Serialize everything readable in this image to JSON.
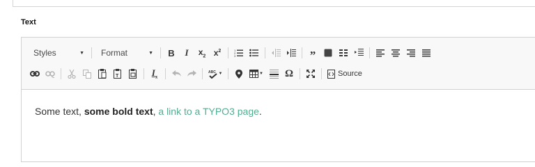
{
  "field": {
    "label": "Text"
  },
  "toolbar": {
    "styles_label": "Styles",
    "format_label": "Format",
    "source_label": "Source",
    "icons_row1": [
      "bold-icon",
      "italic-icon",
      "subscript-icon",
      "superscript-icon",
      "numbered-list-icon",
      "bulleted-list-icon",
      "decrease-indent-icon",
      "increase-indent-icon",
      "blockquote-icon",
      "block-icon",
      "columns-icon",
      "bidi-icon",
      "align-left-icon",
      "align-center-icon",
      "align-right-icon",
      "justify-icon"
    ],
    "icons_row2": [
      "link-icon",
      "unlink-icon",
      "cut-icon",
      "copy-icon",
      "paste-icon",
      "paste-text-icon",
      "paste-word-icon",
      "remove-format-icon",
      "undo-icon",
      "redo-icon",
      "spellcheck-icon",
      "anchor-icon",
      "table-icon",
      "horizontal-line-icon",
      "special-char-icon",
      "maximize-icon",
      "source-icon"
    ]
  },
  "content": {
    "text1": "Some text, ",
    "bold": "some bold text",
    "text2": ", ",
    "link": "a link to a TYPO3 page",
    "text3": "."
  }
}
